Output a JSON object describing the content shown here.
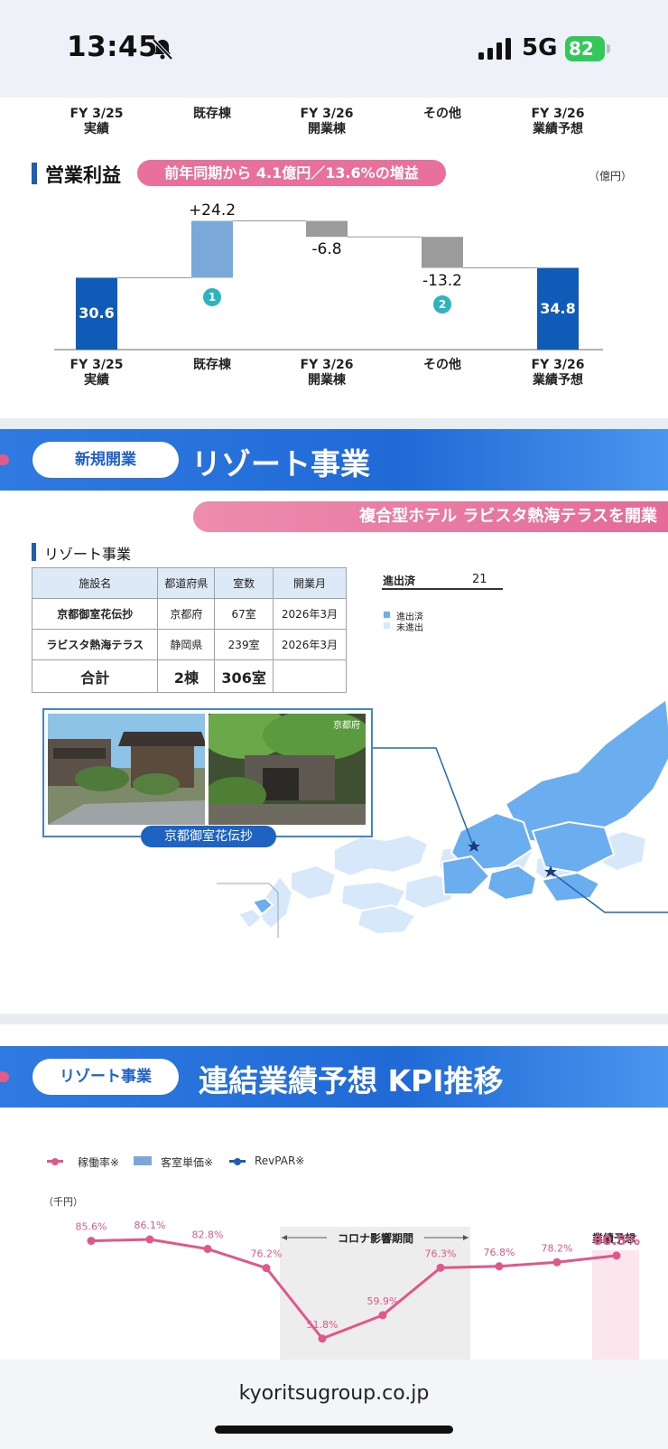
{
  "status_bar": {
    "time": "13:45",
    "network": "5G",
    "battery": "82"
  },
  "waterfall": {
    "top_labels": [
      [
        "FY 3/25",
        "実績"
      ],
      [
        "既存棟",
        ""
      ],
      [
        "FY 3/26",
        "開業棟"
      ],
      [
        "その他",
        ""
      ],
      [
        "FY 3/26",
        "業績予想"
      ]
    ],
    "title": "営業利益",
    "badge": "前年同期から 4.1億円／13.6%の増益",
    "unit": "（億円）",
    "chart_data": {
      "type": "bar",
      "categories": [
        "FY 3/25 実績",
        "既存棟",
        "FY 3/26 開業棟",
        "その他",
        "FY 3/26 業績予想"
      ],
      "values": [
        30.6,
        24.2,
        -6.8,
        -13.2,
        34.8
      ],
      "value_labels": [
        "30.6",
        "+24.2",
        "-6.8",
        "-13.2",
        "34.8"
      ],
      "markers": [
        "",
        "1",
        "",
        "2",
        ""
      ],
      "colors": [
        "#0f5cb8",
        "#7aa8d8",
        "#9b9b9b",
        "#9b9b9b",
        "#0f5cb8"
      ]
    },
    "bottom_labels": [
      [
        "FY 3/25",
        "実績"
      ],
      [
        "既存棟",
        ""
      ],
      [
        "FY 3/26",
        "開業棟"
      ],
      [
        "その他",
        ""
      ],
      [
        "FY 3/26",
        "業績予想"
      ]
    ]
  },
  "resort": {
    "pill": "新規開業",
    "title": "リゾート事業",
    "pink_banner": "複合型ホテル ラビスタ熱海テラスを開業",
    "subtitle": "リゾート事業",
    "table": {
      "headers": [
        "施設名",
        "都道府県",
        "室数",
        "開業月"
      ],
      "rows": [
        [
          "京都御室花伝抄",
          "京都府",
          "67室",
          "2026年3月"
        ],
        [
          "ラビスタ熱海テラス",
          "静岡県",
          "239室",
          "2026年3月"
        ]
      ],
      "total": [
        "合計",
        "2棟",
        "306室",
        ""
      ]
    },
    "map_stat": {
      "label": "進出済",
      "value": "21"
    },
    "map_legend": [
      {
        "label": "進出済",
        "color": "#6aaef0"
      },
      {
        "label": "未進出",
        "color": "#d6e8fa"
      }
    ],
    "photo_tag": "京都府",
    "photo_caption": "京都御室花伝抄"
  },
  "kpi": {
    "pill": "リゾート事業",
    "title": "連結業績予想 KPI推移",
    "legend": [
      {
        "label": "稼働率※",
        "color": "#e0578a",
        "kind": "line"
      },
      {
        "label": "客室単価※",
        "color": "#7aa8d8",
        "kind": "bar"
      },
      {
        "label": "RevPAR※",
        "color": "#1f5fb0",
        "kind": "line"
      }
    ],
    "unit": "（千円）",
    "corona_label": "コロナ影響期間",
    "forecast_label": "業績予想",
    "chart_data": {
      "type": "line",
      "series": [
        {
          "name": "稼働率※",
          "values": [
            85.6,
            86.1,
            82.8,
            76.2,
            51.8,
            59.9,
            76.3,
            76.8,
            78.2,
            80.5
          ],
          "labels": [
            "85.6%",
            "86.1%",
            "82.8%",
            "76.2%",
            "51.8%",
            "59.9%",
            "76.3%",
            "76.8%",
            "78.2%",
            "80.5%"
          ]
        }
      ]
    }
  },
  "footer": {
    "url": "kyoritsugroup.co.jp"
  }
}
